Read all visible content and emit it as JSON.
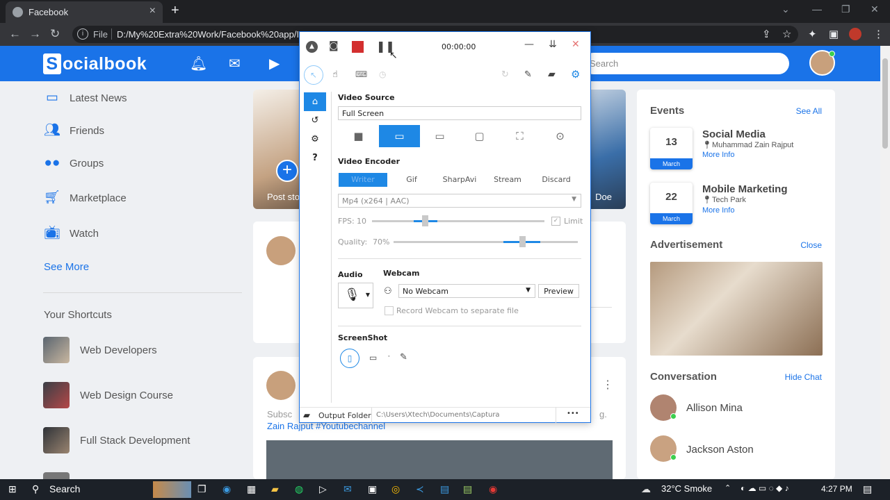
{
  "browser": {
    "tab_title": "Facebook",
    "file_label": "File",
    "url": "D:/My%20Extra%20Work/Facebook%20app/I..."
  },
  "fb": {
    "logo_letter": "S",
    "logo_rest": "ocialbook",
    "search_placeholder": "Search",
    "nav": [
      {
        "label": "Latest News",
        "icon": "news-icon"
      },
      {
        "label": "Friends",
        "icon": "friends-icon"
      },
      {
        "label": "Groups",
        "icon": "groups-icon"
      },
      {
        "label": "Marketplace",
        "icon": "cart-icon"
      },
      {
        "label": "Watch",
        "icon": "tv-icon"
      }
    ],
    "see_more": "See More",
    "shortcuts_title": "Your Shortcuts",
    "shortcuts": [
      "Web Developers",
      "Web Design Course",
      "Full Stack Development"
    ],
    "stories": {
      "post_story": "Post sto",
      "doe": "Doe"
    },
    "post2": {
      "body": "Subsc",
      "body_end": "g.",
      "tag": "Zain Rajput #Youtubechannel"
    },
    "events_title": "Events",
    "events_see_all": "See All",
    "events": [
      {
        "day": "13",
        "month": "March",
        "title": "Social Media",
        "place": "Muhammad Zain Rajput",
        "more": "More Info"
      },
      {
        "day": "22",
        "month": "March",
        "title": "Mobile Marketing",
        "place": "Tech Park",
        "more": "More Info"
      }
    ],
    "ad_title": "Advertisement",
    "ad_close": "Close",
    "conv_title": "Conversation",
    "conv_hide": "Hide Chat",
    "conversations": [
      "Allison Mina",
      "Jackson Aston"
    ]
  },
  "captura": {
    "timer": "00:00:00",
    "video_source_label": "Video Source",
    "video_source_value": "Full Screen",
    "video_encoder_label": "Video Encoder",
    "encoder_tabs": [
      "Writer",
      "Gif",
      "SharpAvi",
      "Stream",
      "Discard"
    ],
    "codec": "Mp4 (x264 | AAC)",
    "fps_label": "FPS:",
    "fps_value": "10",
    "limit_label": "Limit",
    "quality_label": "Quality:",
    "quality_value": "70%",
    "audio_label": "Audio",
    "webcam_label": "Webcam",
    "webcam_value": "No Webcam",
    "preview_label": "Preview",
    "record_webcam_label": "Record Webcam to separate file",
    "screenshot_label": "ScreenShot",
    "output_folder_label": "Output Folder",
    "output_path": "C:\\Users\\Xtech\\Documents\\Captura",
    "more_label": "•••"
  },
  "taskbar": {
    "search": "Search",
    "weather": "32°C  Smoke",
    "time": "4:27 PM"
  }
}
